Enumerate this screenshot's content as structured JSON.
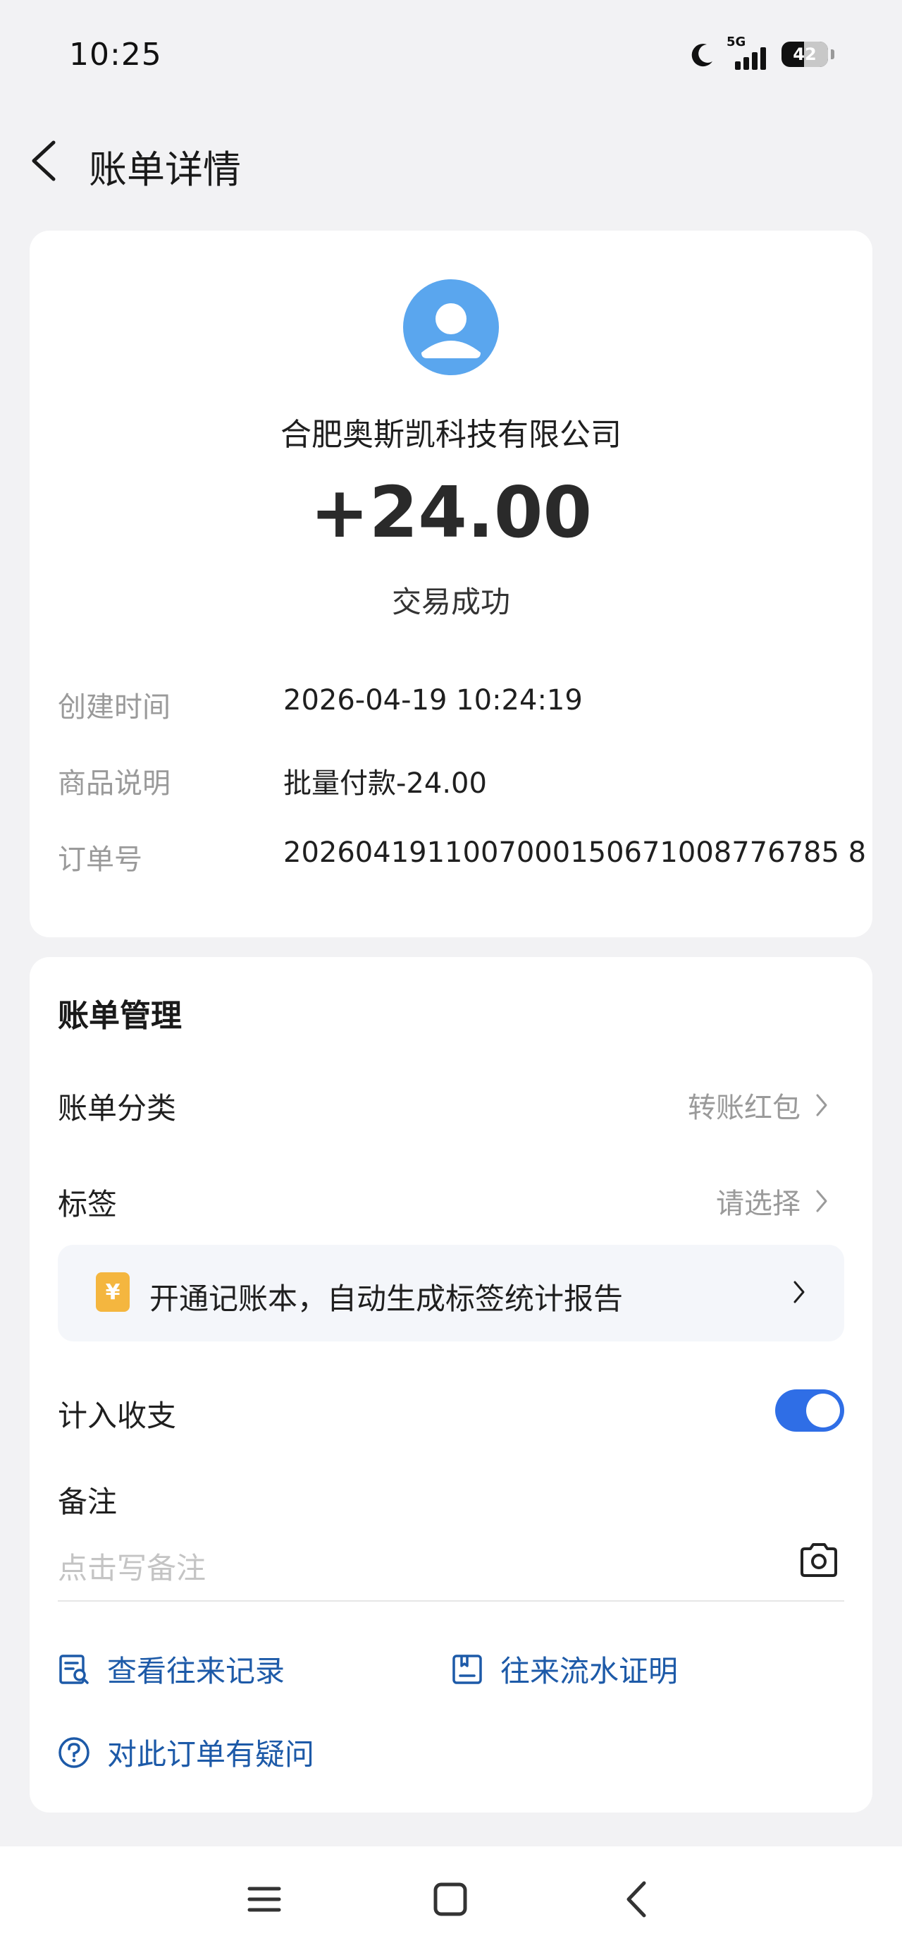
{
  "status_bar": {
    "time": "10:25",
    "network": "5G",
    "battery": "42"
  },
  "header": {
    "title": "账单详情"
  },
  "summary": {
    "merchant": "合肥奥斯凯科技有限公司",
    "amount": "+24.00",
    "status": "交易成功"
  },
  "details": [
    {
      "label": "创建时间",
      "value": "2026-04-19 10:24:19"
    },
    {
      "label": "商品说明",
      "value": "批量付款-24.00"
    },
    {
      "label": "订单号",
      "value": "2026041911007000150671008776785 8"
    }
  ],
  "management": {
    "title": "账单管理",
    "category_label": "账单分类",
    "category_value": "转账红包",
    "tag_label": "标签",
    "tag_value": "请选择",
    "banner_icon": "¥",
    "banner_text": "开通记账本，自动生成标签统计报告",
    "include_label": "计入收支",
    "include_on": true,
    "note_label": "备注",
    "note_placeholder": "点击写备注"
  },
  "links": {
    "records": "查看往来记录",
    "proof": "往来流水证明",
    "question": "对此订单有疑问"
  },
  "colors": {
    "accent": "#2f6ee6",
    "link": "#1d5aa8",
    "avatar": "#5aa6ee",
    "banner_icon": "#f4b63f"
  }
}
